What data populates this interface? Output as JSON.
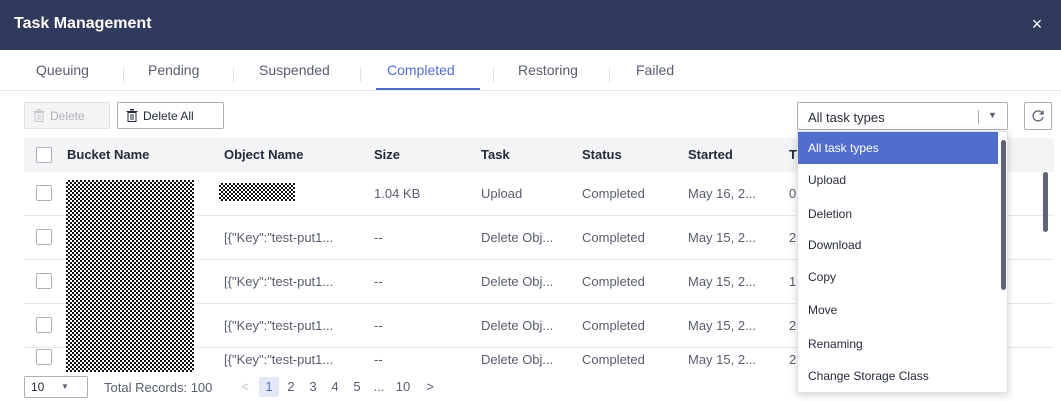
{
  "window": {
    "title": "Task Management",
    "close_label": "×"
  },
  "tabs": [
    {
      "label": "Queuing"
    },
    {
      "label": "Pending"
    },
    {
      "label": "Suspended"
    },
    {
      "label": "Completed"
    },
    {
      "label": "Restoring"
    },
    {
      "label": "Failed"
    }
  ],
  "active_tab": "Completed",
  "toolbar": {
    "delete_label": "Delete",
    "delete_all_label": "Delete All",
    "task_type_selected": "All task types"
  },
  "table": {
    "columns": [
      "Bucket Name",
      "Object Name",
      "Size",
      "Task",
      "Status",
      "Started",
      "T"
    ],
    "rows": [
      {
        "object": "",
        "size": "1.04 KB",
        "task": "Upload",
        "status": "Completed",
        "started": "May 16, 2...",
        "t": "0"
      },
      {
        "object": "[{\"Key\":\"test-put1...",
        "size": "--",
        "task": "Delete Obj...",
        "status": "Completed",
        "started": "May 15, 2...",
        "t": "2"
      },
      {
        "object": "[{\"Key\":\"test-put1...",
        "size": "--",
        "task": "Delete Obj...",
        "status": "Completed",
        "started": "May 15, 2...",
        "t": "1"
      },
      {
        "object": "[{\"Key\":\"test-put1...",
        "size": "--",
        "task": "Delete Obj...",
        "status": "Completed",
        "started": "May 15, 2...",
        "t": "2"
      },
      {
        "object": "[{\"Key\":\"test-put1...",
        "size": "--",
        "task": "Delete Obj...",
        "status": "Completed",
        "started": "May 15, 2...",
        "t": "2"
      }
    ]
  },
  "dropdown": {
    "options": [
      "All task types",
      "Upload",
      "Deletion",
      "Download",
      "Copy",
      "Move",
      "Renaming",
      "Change Storage Class"
    ],
    "highlighted": "All task types"
  },
  "pagination": {
    "page_size": "10",
    "total_records": "Total Records: 100",
    "prev": "<",
    "next": ">",
    "pages": [
      "1",
      "2",
      "3",
      "4",
      "5",
      "...",
      "10"
    ],
    "current_page": "1"
  },
  "colors": {
    "header_bg": "#2f3a5c",
    "accent": "#526ecc"
  },
  "icons": {
    "close": "close-icon",
    "delete": "trash-icon",
    "refresh": "refresh-icon",
    "dropdown": "chevron-down-icon"
  }
}
